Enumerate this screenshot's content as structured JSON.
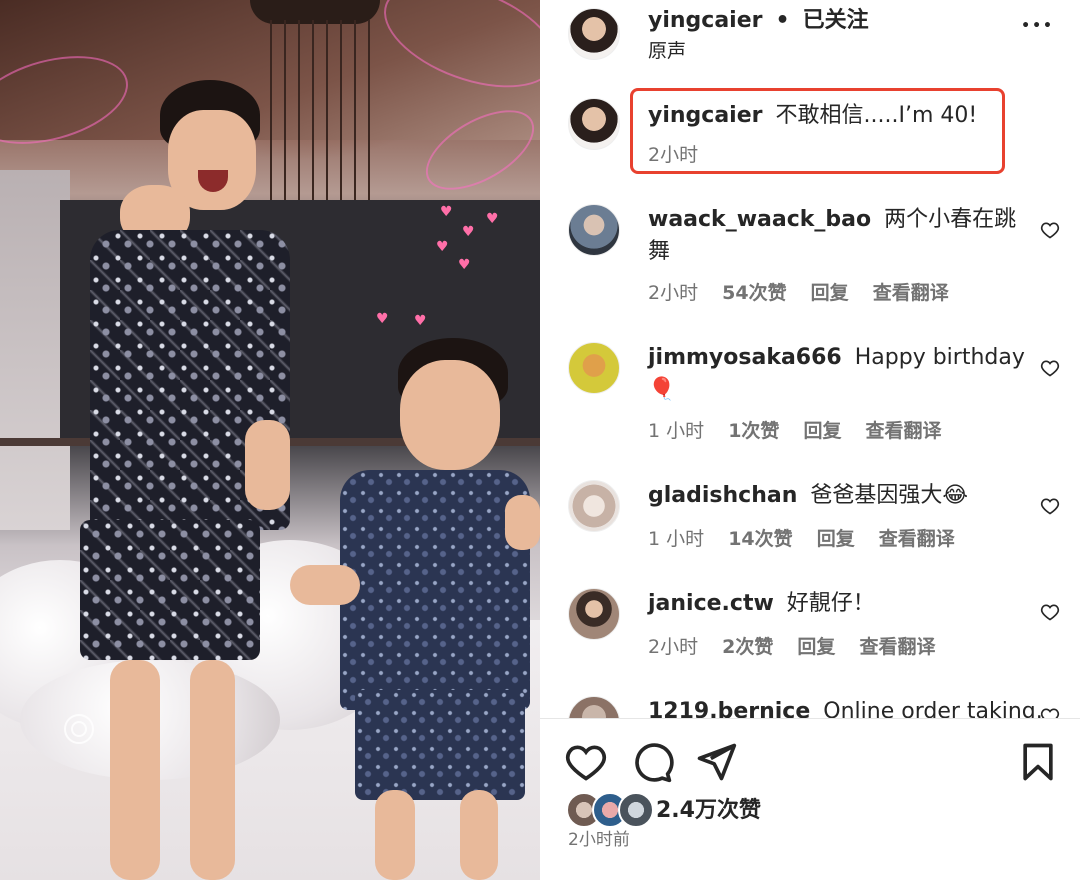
{
  "header": {
    "username": "yingcaier",
    "dot": "•",
    "follow_status": "已关注",
    "audio_label": "原声",
    "more_label": "•••"
  },
  "caption": {
    "username": "yingcaier",
    "text": "不敢相信.....I’m 40!",
    "time": "2小时"
  },
  "comments": [
    {
      "username": "waack_waack_bao",
      "text_line1": "两个小春在跳",
      "text_line2": "舞",
      "time": "2小时",
      "likes": "54次赞",
      "reply": "回复",
      "translate": "查看翻译"
    },
    {
      "username": "jimmyosaka666",
      "text_line1": "Happy birthday",
      "text_line2": "🎈",
      "time": "1 小时",
      "likes": "1次赞",
      "reply": "回复",
      "translate": "查看翻译"
    },
    {
      "username": "gladishchan",
      "text_line1": "爸爸基因强大😂",
      "text_line2": "",
      "time": "1 小时",
      "likes": "14次赞",
      "reply": "回复",
      "translate": "查看翻译"
    },
    {
      "username": "janice.ctw",
      "text_line1": "好靚仔！",
      "text_line2": "",
      "time": "2小时",
      "likes": "2次赞",
      "reply": "回复",
      "translate": "查看翻译"
    },
    {
      "username": "1219.bernice",
      "text_line1": "Online order taking.",
      "text_line2": "",
      "time": "",
      "likes": "",
      "reply": "",
      "translate": ""
    }
  ],
  "footer": {
    "likes_count": "2.4万次赞",
    "posted_time": "2小时前"
  },
  "icons": {
    "like": "heart-icon",
    "comment": "comment-icon",
    "share": "share-icon",
    "save": "bookmark-icon",
    "more": "more-icon"
  },
  "colors": {
    "highlight": "#e8412f",
    "secondary_text": "#737373",
    "primary_text": "#262626"
  }
}
